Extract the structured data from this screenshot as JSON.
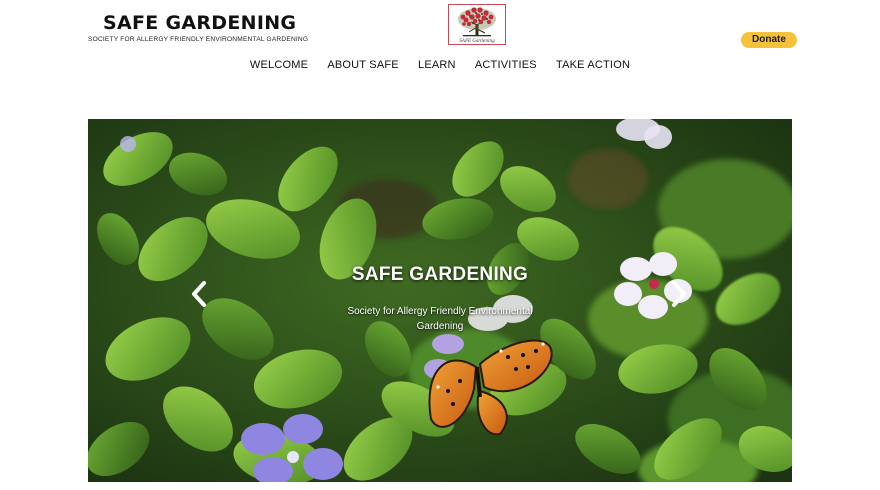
{
  "header": {
    "title": "SAFE GARDENING",
    "subtitle": "SOCIETY FOR ALLERGY FRIENDLY ENVIRONMENTAL GARDENING",
    "logo_caption": "SAFE Gardening",
    "donate_label": "Donate"
  },
  "nav": {
    "items": [
      {
        "label": "WELCOME"
      },
      {
        "label": "ABOUT SAFE"
      },
      {
        "label": "LEARN"
      },
      {
        "label": "ACTIVITIES"
      },
      {
        "label": "TAKE ACTION"
      }
    ]
  },
  "hero": {
    "title": "SAFE GARDENING",
    "subtitle": "Society for Allergy Friendly  Environmental Gardening",
    "prev_icon": "chevron-left-icon",
    "next_icon": "chevron-right-icon"
  },
  "colors": {
    "donate": "#f5c23c",
    "logo_border": "#c84a55"
  }
}
